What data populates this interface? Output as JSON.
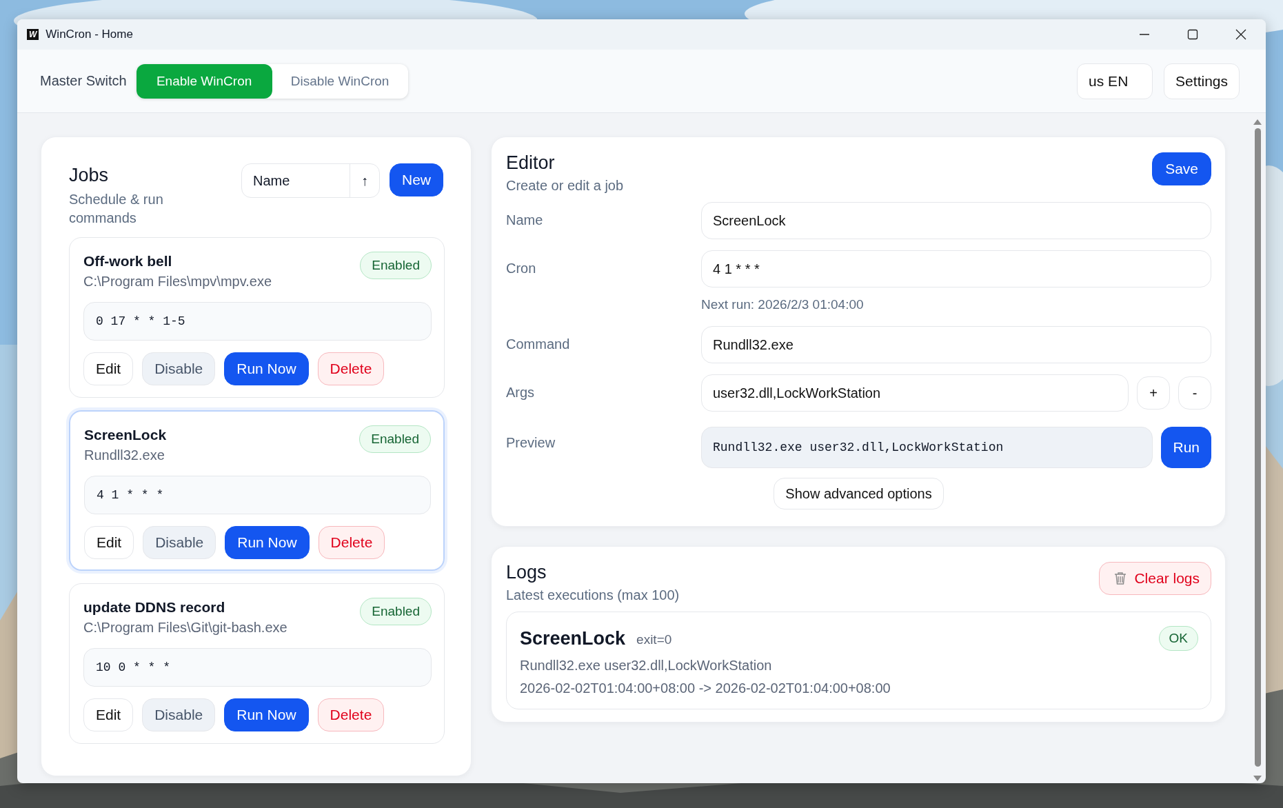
{
  "window": {
    "title": "WinCron - Home",
    "app_logo": "W"
  },
  "header": {
    "master_switch": {
      "label": "Master Switch",
      "options": [
        {
          "label": "Enable WinCron",
          "selected": true
        },
        {
          "label": "Disable WinCron",
          "selected": false
        }
      ]
    },
    "language": "us EN",
    "settings": "Settings"
  },
  "jobs": {
    "title": "Jobs",
    "subtitle": "Schedule & run commands",
    "sort": {
      "field": "Name",
      "direction": "↑"
    },
    "new_button": "New",
    "items": [
      {
        "name": "Off-work bell",
        "command": "C:\\Program Files\\mpv\\mpv.exe",
        "status": "Enabled",
        "enabled": true,
        "cron": "0 17 * * 1-5",
        "selected": false,
        "actions": [
          {
            "label": "Edit",
            "kind": "edit"
          },
          {
            "label": "Disable",
            "kind": "toggle"
          },
          {
            "label": "Run Now",
            "kind": "run"
          },
          {
            "label": "Delete",
            "kind": "delete"
          }
        ]
      },
      {
        "name": "ScreenLock",
        "command": "Rundll32.exe",
        "status": "Enabled",
        "enabled": true,
        "cron": "4 1 * * *",
        "selected": true,
        "actions": [
          {
            "label": "Edit",
            "kind": "edit"
          },
          {
            "label": "Disable",
            "kind": "toggle"
          },
          {
            "label": "Run Now",
            "kind": "run"
          },
          {
            "label": "Delete",
            "kind": "delete"
          }
        ]
      },
      {
        "name": "update DDNS record",
        "command": "C:\\Program Files\\Git\\git-bash.exe",
        "status": "Enabled",
        "enabled": true,
        "cron": "10 0 * * *",
        "selected": false,
        "actions": [
          {
            "label": "Edit",
            "kind": "edit"
          },
          {
            "label": "Disable",
            "kind": "toggle"
          },
          {
            "label": "Run Now",
            "kind": "run"
          },
          {
            "label": "Delete",
            "kind": "delete"
          }
        ]
      }
    ]
  },
  "editor": {
    "title": "Editor",
    "subtitle": "Create or edit a job",
    "save": "Save",
    "fields": [
      {
        "kind": "text",
        "label": "Name",
        "value": "ScreenLock"
      },
      {
        "kind": "text",
        "label": "Cron",
        "value": "4 1 * * *",
        "hint": "Next run: 2026/2/3 01:04:00"
      },
      {
        "kind": "text",
        "label": "Command",
        "value": "Rundll32.exe"
      },
      {
        "kind": "args",
        "label": "Args",
        "value": "user32.dll,LockWorkStation",
        "add": "+",
        "remove": "-"
      },
      {
        "kind": "preview",
        "label": "Preview",
        "value": "Rundll32.exe user32.dll,LockWorkStation",
        "run": "Run"
      }
    ],
    "advanced": "Show advanced options"
  },
  "logs": {
    "title": "Logs",
    "subtitle": "Latest executions (max 100)",
    "clear": "Clear logs",
    "entries": [
      {
        "name": "ScreenLock",
        "exit": "exit=0",
        "status": "OK",
        "ok": true,
        "command": "Rundll32.exe user32.dll,LockWorkStation",
        "time": "2026-02-02T01:04:00+08:00 -> 2026-02-02T01:04:00+08:00"
      }
    ]
  }
}
